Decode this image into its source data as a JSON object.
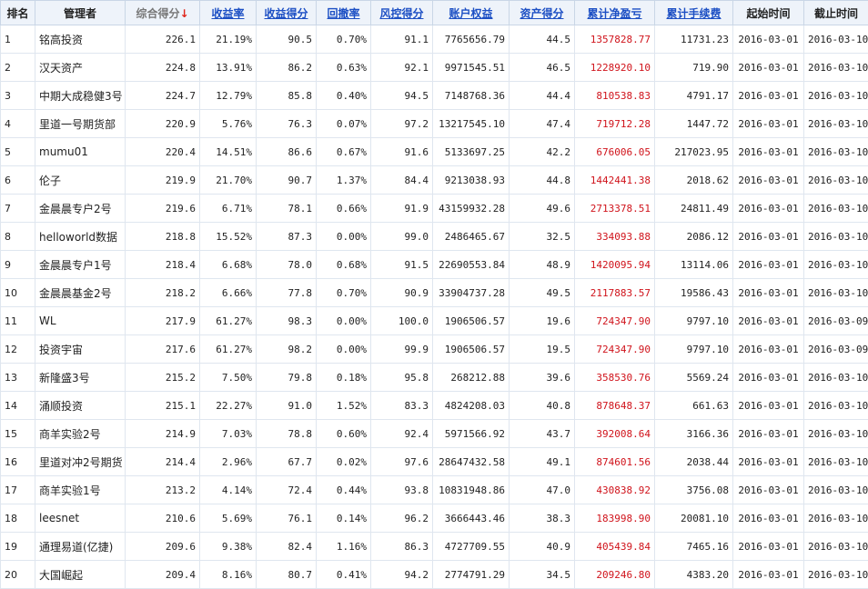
{
  "columns": [
    {
      "key": "rank",
      "label": "排名",
      "kind": "plain"
    },
    {
      "key": "manager",
      "label": "管理者",
      "kind": "plain"
    },
    {
      "key": "total_score",
      "label": "综合得分",
      "kind": "active",
      "sort_icon": "arrow-down-icon"
    },
    {
      "key": "return_rate",
      "label": "收益率",
      "kind": "sortable"
    },
    {
      "key": "return_score",
      "label": "收益得分",
      "kind": "sortable"
    },
    {
      "key": "drawdown",
      "label": "回撤率",
      "kind": "sortable"
    },
    {
      "key": "risk_score",
      "label": "风控得分",
      "kind": "sortable"
    },
    {
      "key": "equity",
      "label": "账户权益",
      "kind": "sortable"
    },
    {
      "key": "asset_score",
      "label": "资产得分",
      "kind": "sortable"
    },
    {
      "key": "net_profit",
      "label": "累计净盈亏",
      "kind": "sortable"
    },
    {
      "key": "fees",
      "label": "累计手续费",
      "kind": "sortable"
    },
    {
      "key": "start_date",
      "label": "起始时间",
      "kind": "plain"
    },
    {
      "key": "end_date",
      "label": "截止时间",
      "kind": "plain"
    }
  ],
  "colors": {
    "profit": "#d0131b",
    "link": "#1c4fc4",
    "header_bg": "#eef3fa"
  },
  "rows": [
    {
      "rank": "1",
      "manager": "铭高投资",
      "total_score": "226.1",
      "return_rate": "21.19%",
      "return_score": "90.5",
      "drawdown": "0.70%",
      "risk_score": "91.1",
      "equity": "7765656.79",
      "asset_score": "44.5",
      "net_profit": "1357828.77",
      "fees": "11731.23",
      "start_date": "2016-03-01",
      "end_date": "2016-03-10"
    },
    {
      "rank": "2",
      "manager": "汉天资产",
      "total_score": "224.8",
      "return_rate": "13.91%",
      "return_score": "86.2",
      "drawdown": "0.63%",
      "risk_score": "92.1",
      "equity": "9971545.51",
      "asset_score": "46.5",
      "net_profit": "1228920.10",
      "fees": "719.90",
      "start_date": "2016-03-01",
      "end_date": "2016-03-10"
    },
    {
      "rank": "3",
      "manager": "中期大成稳健3号",
      "total_score": "224.7",
      "return_rate": "12.79%",
      "return_score": "85.8",
      "drawdown": "0.40%",
      "risk_score": "94.5",
      "equity": "7148768.36",
      "asset_score": "44.4",
      "net_profit": "810538.83",
      "fees": "4791.17",
      "start_date": "2016-03-01",
      "end_date": "2016-03-10"
    },
    {
      "rank": "4",
      "manager": "里道一号期货部",
      "total_score": "220.9",
      "return_rate": "5.76%",
      "return_score": "76.3",
      "drawdown": "0.07%",
      "risk_score": "97.2",
      "equity": "13217545.10",
      "asset_score": "47.4",
      "net_profit": "719712.28",
      "fees": "1447.72",
      "start_date": "2016-03-01",
      "end_date": "2016-03-10"
    },
    {
      "rank": "5",
      "manager": "mumu01",
      "total_score": "220.4",
      "return_rate": "14.51%",
      "return_score": "86.6",
      "drawdown": "0.67%",
      "risk_score": "91.6",
      "equity": "5133697.25",
      "asset_score": "42.2",
      "net_profit": "676006.05",
      "fees": "217023.95",
      "start_date": "2016-03-01",
      "end_date": "2016-03-10"
    },
    {
      "rank": "6",
      "manager": "伦子",
      "total_score": "219.9",
      "return_rate": "21.70%",
      "return_score": "90.7",
      "drawdown": "1.37%",
      "risk_score": "84.4",
      "equity": "9213038.93",
      "asset_score": "44.8",
      "net_profit": "1442441.38",
      "fees": "2018.62",
      "start_date": "2016-03-01",
      "end_date": "2016-03-10"
    },
    {
      "rank": "7",
      "manager": "金晨晨专户2号",
      "total_score": "219.6",
      "return_rate": "6.71%",
      "return_score": "78.1",
      "drawdown": "0.66%",
      "risk_score": "91.9",
      "equity": "43159932.28",
      "asset_score": "49.6",
      "net_profit": "2713378.51",
      "fees": "24811.49",
      "start_date": "2016-03-01",
      "end_date": "2016-03-10"
    },
    {
      "rank": "8",
      "manager": "helloworld数据",
      "total_score": "218.8",
      "return_rate": "15.52%",
      "return_score": "87.3",
      "drawdown": "0.00%",
      "risk_score": "99.0",
      "equity": "2486465.67",
      "asset_score": "32.5",
      "net_profit": "334093.88",
      "fees": "2086.12",
      "start_date": "2016-03-01",
      "end_date": "2016-03-10"
    },
    {
      "rank": "9",
      "manager": "金晨晨专户1号",
      "total_score": "218.4",
      "return_rate": "6.68%",
      "return_score": "78.0",
      "drawdown": "0.68%",
      "risk_score": "91.5",
      "equity": "22690553.84",
      "asset_score": "48.9",
      "net_profit": "1420095.94",
      "fees": "13114.06",
      "start_date": "2016-03-01",
      "end_date": "2016-03-10"
    },
    {
      "rank": "10",
      "manager": "金晨晨基金2号",
      "total_score": "218.2",
      "return_rate": "6.66%",
      "return_score": "77.8",
      "drawdown": "0.70%",
      "risk_score": "90.9",
      "equity": "33904737.28",
      "asset_score": "49.5",
      "net_profit": "2117883.57",
      "fees": "19586.43",
      "start_date": "2016-03-01",
      "end_date": "2016-03-10"
    },
    {
      "rank": "11",
      "manager": "WL",
      "total_score": "217.9",
      "return_rate": "61.27%",
      "return_score": "98.3",
      "drawdown": "0.00%",
      "risk_score": "100.0",
      "equity": "1906506.57",
      "asset_score": "19.6",
      "net_profit": "724347.90",
      "fees": "9797.10",
      "start_date": "2016-03-01",
      "end_date": "2016-03-09"
    },
    {
      "rank": "12",
      "manager": "投资宇宙",
      "total_score": "217.6",
      "return_rate": "61.27%",
      "return_score": "98.2",
      "drawdown": "0.00%",
      "risk_score": "99.9",
      "equity": "1906506.57",
      "asset_score": "19.5",
      "net_profit": "724347.90",
      "fees": "9797.10",
      "start_date": "2016-03-01",
      "end_date": "2016-03-09"
    },
    {
      "rank": "13",
      "manager": "新隆盛3号",
      "total_score": "215.2",
      "return_rate": "7.50%",
      "return_score": "79.8",
      "drawdown": "0.18%",
      "risk_score": "95.8",
      "equity": "268212.88",
      "asset_score": "39.6",
      "net_profit": "358530.76",
      "fees": "5569.24",
      "start_date": "2016-03-01",
      "end_date": "2016-03-10"
    },
    {
      "rank": "14",
      "manager": "涌顺投资",
      "total_score": "215.1",
      "return_rate": "22.27%",
      "return_score": "91.0",
      "drawdown": "1.52%",
      "risk_score": "83.3",
      "equity": "4824208.03",
      "asset_score": "40.8",
      "net_profit": "878648.37",
      "fees": "661.63",
      "start_date": "2016-03-01",
      "end_date": "2016-03-10"
    },
    {
      "rank": "15",
      "manager": "商羊实验2号",
      "total_score": "214.9",
      "return_rate": "7.03%",
      "return_score": "78.8",
      "drawdown": "0.60%",
      "risk_score": "92.4",
      "equity": "5971566.92",
      "asset_score": "43.7",
      "net_profit": "392008.64",
      "fees": "3166.36",
      "start_date": "2016-03-01",
      "end_date": "2016-03-10"
    },
    {
      "rank": "16",
      "manager": "里道对冲2号期货",
      "total_score": "214.4",
      "return_rate": "2.96%",
      "return_score": "67.7",
      "drawdown": "0.02%",
      "risk_score": "97.6",
      "equity": "28647432.58",
      "asset_score": "49.1",
      "net_profit": "874601.56",
      "fees": "2038.44",
      "start_date": "2016-03-01",
      "end_date": "2016-03-10"
    },
    {
      "rank": "17",
      "manager": "商羊实验1号",
      "total_score": "213.2",
      "return_rate": "4.14%",
      "return_score": "72.4",
      "drawdown": "0.44%",
      "risk_score": "93.8",
      "equity": "10831948.86",
      "asset_score": "47.0",
      "net_profit": "430838.92",
      "fees": "3756.08",
      "start_date": "2016-03-01",
      "end_date": "2016-03-10"
    },
    {
      "rank": "18",
      "manager": "leesnet",
      "total_score": "210.6",
      "return_rate": "5.69%",
      "return_score": "76.1",
      "drawdown": "0.14%",
      "risk_score": "96.2",
      "equity": "3666443.46",
      "asset_score": "38.3",
      "net_profit": "183998.90",
      "fees": "20081.10",
      "start_date": "2016-03-01",
      "end_date": "2016-03-10"
    },
    {
      "rank": "19",
      "manager": "通理易道(亿捷)",
      "total_score": "209.6",
      "return_rate": "9.38%",
      "return_score": "82.4",
      "drawdown": "1.16%",
      "risk_score": "86.3",
      "equity": "4727709.55",
      "asset_score": "40.9",
      "net_profit": "405439.84",
      "fees": "7465.16",
      "start_date": "2016-03-01",
      "end_date": "2016-03-10"
    },
    {
      "rank": "20",
      "manager": "大国崛起",
      "total_score": "209.4",
      "return_rate": "8.16%",
      "return_score": "80.7",
      "drawdown": "0.41%",
      "risk_score": "94.2",
      "equity": "2774791.29",
      "asset_score": "34.5",
      "net_profit": "209246.80",
      "fees": "4383.20",
      "start_date": "2016-03-01",
      "end_date": "2016-03-10"
    }
  ]
}
